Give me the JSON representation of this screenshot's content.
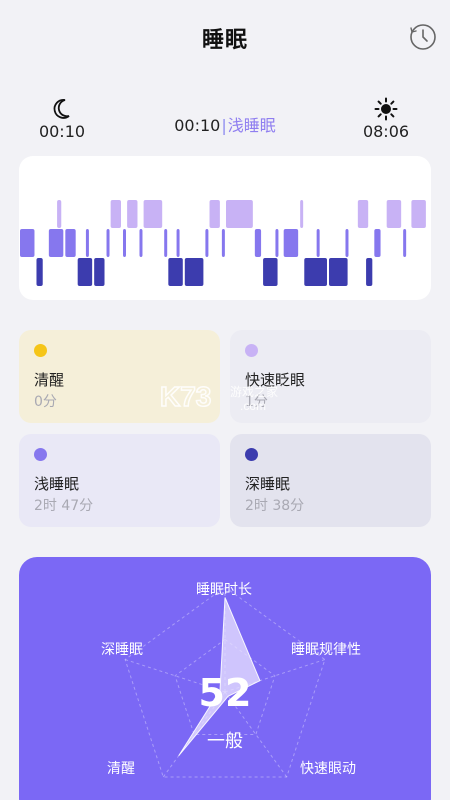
{
  "header": {
    "title": "睡眠",
    "history_icon": "clock-icon"
  },
  "times": {
    "bed_time": "00:10",
    "wake_time": "08:06",
    "current_time": "00:10",
    "separator": "|",
    "current_stage": "浅睡眠",
    "bed_icon": "moon-icon",
    "wake_icon": "sun-icon"
  },
  "colors": {
    "awake": "#f5c518",
    "rem": "#c8b2f5",
    "light": "#8677ee",
    "deep": "#3c3cae",
    "accent": "#7b68f5"
  },
  "stages": [
    {
      "id": "awake",
      "name": "清醒",
      "duration": "0分"
    },
    {
      "id": "rem",
      "name": "快速眨眼",
      "duration": "1分"
    },
    {
      "id": "light",
      "name": "浅睡眠",
      "duration": "2时 47分"
    },
    {
      "id": "deep",
      "name": "深睡眠",
      "duration": "2时 38分"
    }
  ],
  "watermark": {
    "brand": "K73",
    "site": "游戏之家",
    "domain": ".com"
  },
  "score": {
    "value": "52",
    "level": "一般",
    "dimensions": [
      {
        "label": "睡眠时长",
        "value": 0.9
      },
      {
        "label": "睡眠规律性",
        "value": 0.35
      },
      {
        "label": "快速眼动",
        "value": 0.05
      },
      {
        "label": "清醒",
        "value": 0.75
      },
      {
        "label": "深睡眠",
        "value": 0.05
      }
    ]
  },
  "chart_data": {
    "type": "timeline",
    "stages_order": [
      "rem",
      "light",
      "deep"
    ],
    "segments": [
      {
        "stage": "light",
        "start": 0,
        "end": 4
      },
      {
        "stage": "rem",
        "start": 9,
        "end": 10.5
      },
      {
        "stage": "light",
        "start": 7,
        "end": 11
      },
      {
        "stage": "deep",
        "start": 4,
        "end": 6
      },
      {
        "stage": "light",
        "start": 11,
        "end": 14
      },
      {
        "stage": "deep",
        "start": 14,
        "end": 18
      },
      {
        "stage": "light",
        "start": 16,
        "end": 17
      },
      {
        "stage": "deep",
        "start": 18,
        "end": 21
      },
      {
        "stage": "light",
        "start": 21,
        "end": 22
      },
      {
        "stage": "rem",
        "start": 22,
        "end": 25
      },
      {
        "stage": "light",
        "start": 25,
        "end": 26
      },
      {
        "stage": "rem",
        "start": 26,
        "end": 29
      },
      {
        "stage": "light",
        "start": 29,
        "end": 30
      },
      {
        "stage": "rem",
        "start": 30,
        "end": 35
      },
      {
        "stage": "light",
        "start": 35,
        "end": 36
      },
      {
        "stage": "deep",
        "start": 36,
        "end": 40
      },
      {
        "stage": "light",
        "start": 38,
        "end": 39
      },
      {
        "stage": "deep",
        "start": 40,
        "end": 45
      },
      {
        "stage": "light",
        "start": 45,
        "end": 46
      },
      {
        "stage": "rem",
        "start": 46,
        "end": 49
      },
      {
        "stage": "light",
        "start": 49,
        "end": 50
      },
      {
        "stage": "rem",
        "start": 50,
        "end": 57
      },
      {
        "stage": "light",
        "start": 57,
        "end": 59
      },
      {
        "stage": "deep",
        "start": 59,
        "end": 63
      },
      {
        "stage": "light",
        "start": 62,
        "end": 63
      },
      {
        "stage": "light",
        "start": 64,
        "end": 68
      },
      {
        "stage": "rem",
        "start": 68,
        "end": 69
      },
      {
        "stage": "deep",
        "start": 69,
        "end": 75
      },
      {
        "stage": "light",
        "start": 72,
        "end": 73
      },
      {
        "stage": "deep",
        "start": 75,
        "end": 80
      },
      {
        "stage": "light",
        "start": 79,
        "end": 80
      },
      {
        "stage": "rem",
        "start": 82,
        "end": 85
      },
      {
        "stage": "deep",
        "start": 84,
        "end": 86
      },
      {
        "stage": "light",
        "start": 86,
        "end": 88
      },
      {
        "stage": "rem",
        "start": 89,
        "end": 93
      },
      {
        "stage": "light",
        "start": 93,
        "end": 94
      },
      {
        "stage": "rem",
        "start": 95,
        "end": 99
      }
    ],
    "x_range": [
      0,
      100
    ]
  }
}
